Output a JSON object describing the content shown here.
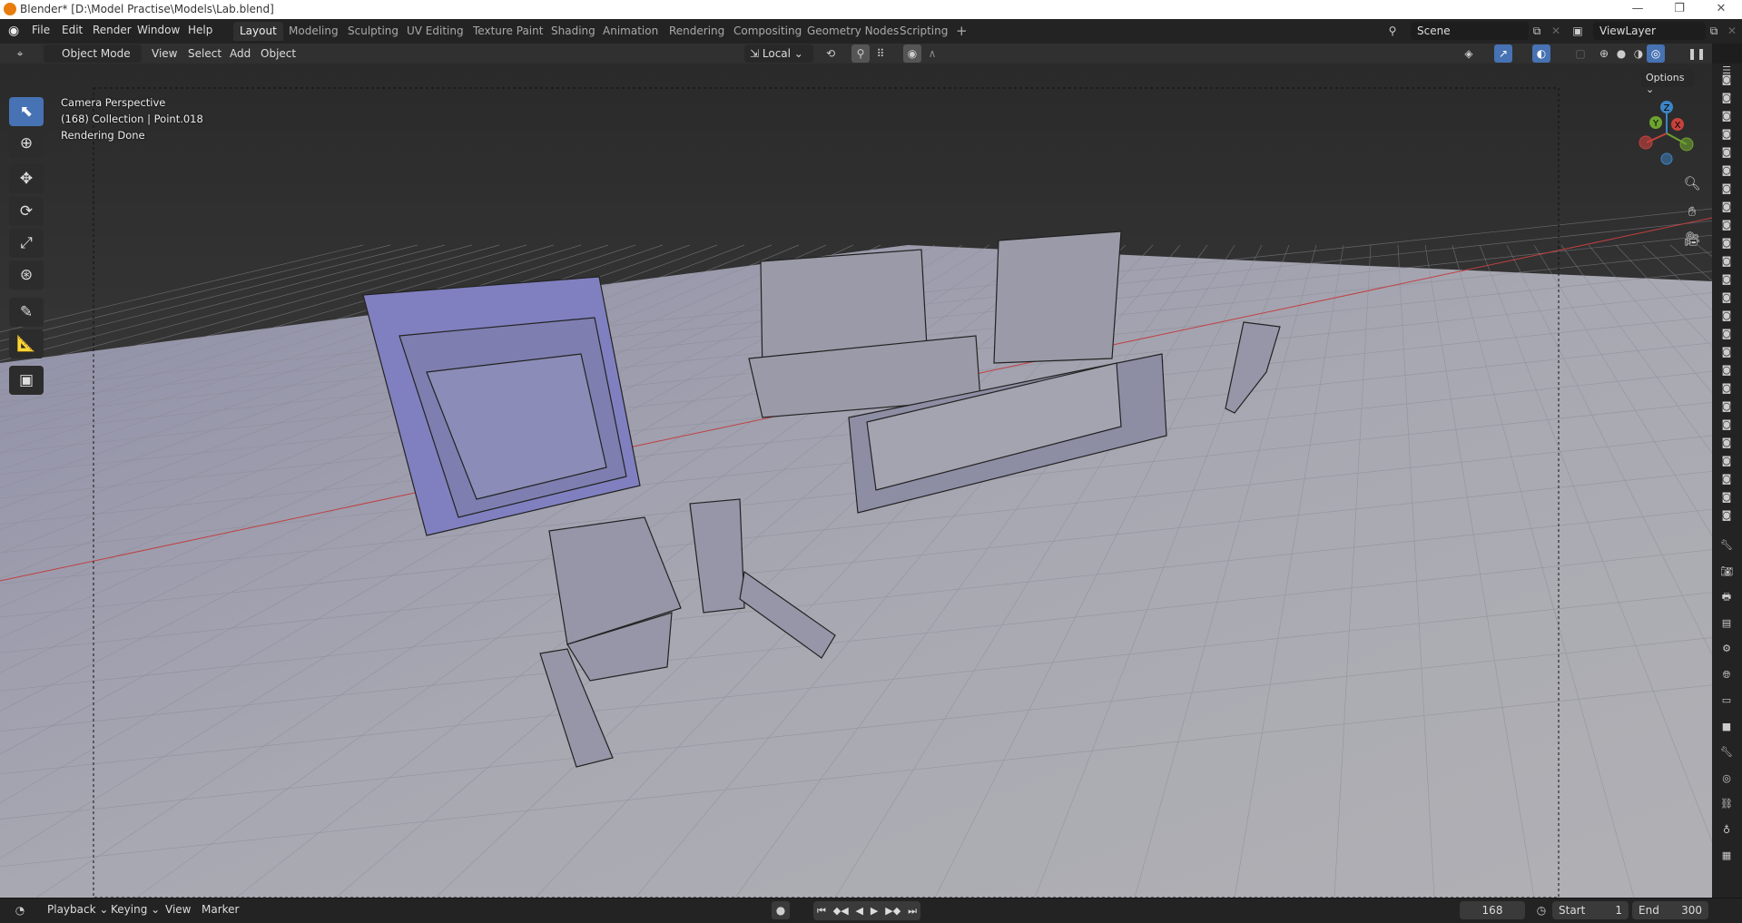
{
  "window": {
    "title": "Blender* [D:\\Model Practise\\Models\\Lab.blend]",
    "minimize": "—",
    "restore": "❐",
    "close": "✕"
  },
  "menu": [
    "File",
    "Edit",
    "Render",
    "Window",
    "Help"
  ],
  "workspaces": [
    "Layout",
    "Modeling",
    "Sculpting",
    "UV Editing",
    "Texture Paint",
    "Shading",
    "Animation",
    "Rendering",
    "Compositing",
    "Geometry Nodes",
    "Scripting"
  ],
  "add_workspace": "+",
  "scene": {
    "name": "Scene",
    "view_layer": "ViewLayer"
  },
  "header": {
    "mode": "Object Mode",
    "view": "View",
    "select": "Select",
    "add": "Add",
    "object": "Object",
    "transform_orientation": "Local",
    "options": "Options"
  },
  "overlay": {
    "line1": "Camera Perspective",
    "line2": "(168) Collection | Point.018",
    "line3": "Rendering Done"
  },
  "gizmo": {
    "x": "X",
    "y": "Y",
    "z": "Z"
  },
  "timeline": {
    "playback": "Playback",
    "keying": "Keying",
    "view": "View",
    "marker": "Marker",
    "current_frame": "168",
    "start_label": "Start",
    "start": "1",
    "end_label": "End",
    "end": "300"
  },
  "colors": {
    "accent": "#4772b3",
    "x_axis": "#c8413d",
    "y_axis": "#6ea32f",
    "z_axis": "#3d85c6"
  }
}
